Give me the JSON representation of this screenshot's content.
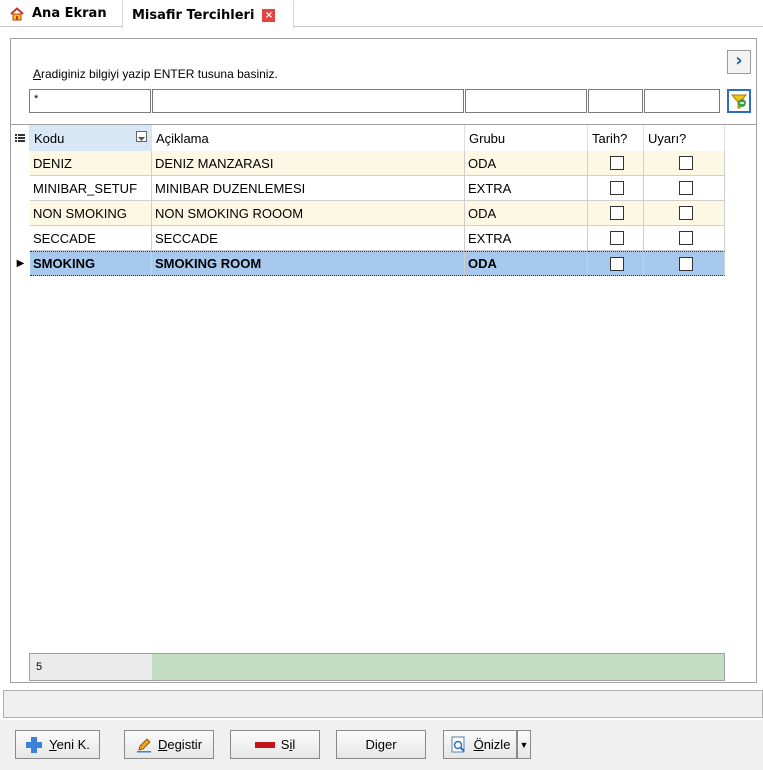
{
  "tabs": [
    {
      "label": "Ana Ekran",
      "icon": "home-icon"
    },
    {
      "label": "Misafir Tercihleri",
      "icon": "close-icon",
      "active": true
    }
  ],
  "search": {
    "hint_underlined": "A",
    "hint_rest": "radiginiz bilgiyi yazip ENTER tusuna basiniz.",
    "filter_values": [
      "*",
      "",
      "",
      "",
      ""
    ]
  },
  "grid": {
    "columns": [
      "Kodu",
      "Açiklama",
      "Grubu",
      "Tarih?",
      "Uyarı?"
    ],
    "rows": [
      {
        "kodu": "DENIZ",
        "aciklama": "DENIZ MANZARASI",
        "grubu": "ODA",
        "tarih": false,
        "uyari": false
      },
      {
        "kodu": "MINIBAR_SETUF",
        "aciklama": "MINIBAR DUZENLEMESI",
        "grubu": "EXTRA",
        "tarih": false,
        "uyari": false
      },
      {
        "kodu": "NON SMOKING",
        "aciklama": "NON SMOKING ROOOM",
        "grubu": "ODA",
        "tarih": false,
        "uyari": false
      },
      {
        "kodu": "SECCADE",
        "aciklama": "SECCADE",
        "grubu": "EXTRA",
        "tarih": false,
        "uyari": false
      },
      {
        "kodu": "SMOKING",
        "aciklama": "SMOKING ROOM",
        "grubu": "ODA",
        "tarih": false,
        "uyari": false,
        "selected": true
      }
    ],
    "record_count": "5"
  },
  "buttons": {
    "yeni": {
      "u": "Y",
      "rest": "eni K."
    },
    "degistir": {
      "u": "D",
      "rest": "egistir"
    },
    "sil": {
      "pre": "S",
      "u": "i",
      "rest": "l"
    },
    "diger": {
      "pre": "Di",
      "u": "g",
      "rest": "er"
    },
    "onizle": {
      "u": "Ö",
      "rest": "nizle"
    }
  },
  "colors": {
    "accent": "#2c6fc0",
    "row_alt": "#fdf8e3",
    "selected_row": "#a8c9ee",
    "summary_green": "#c3ddc3"
  }
}
